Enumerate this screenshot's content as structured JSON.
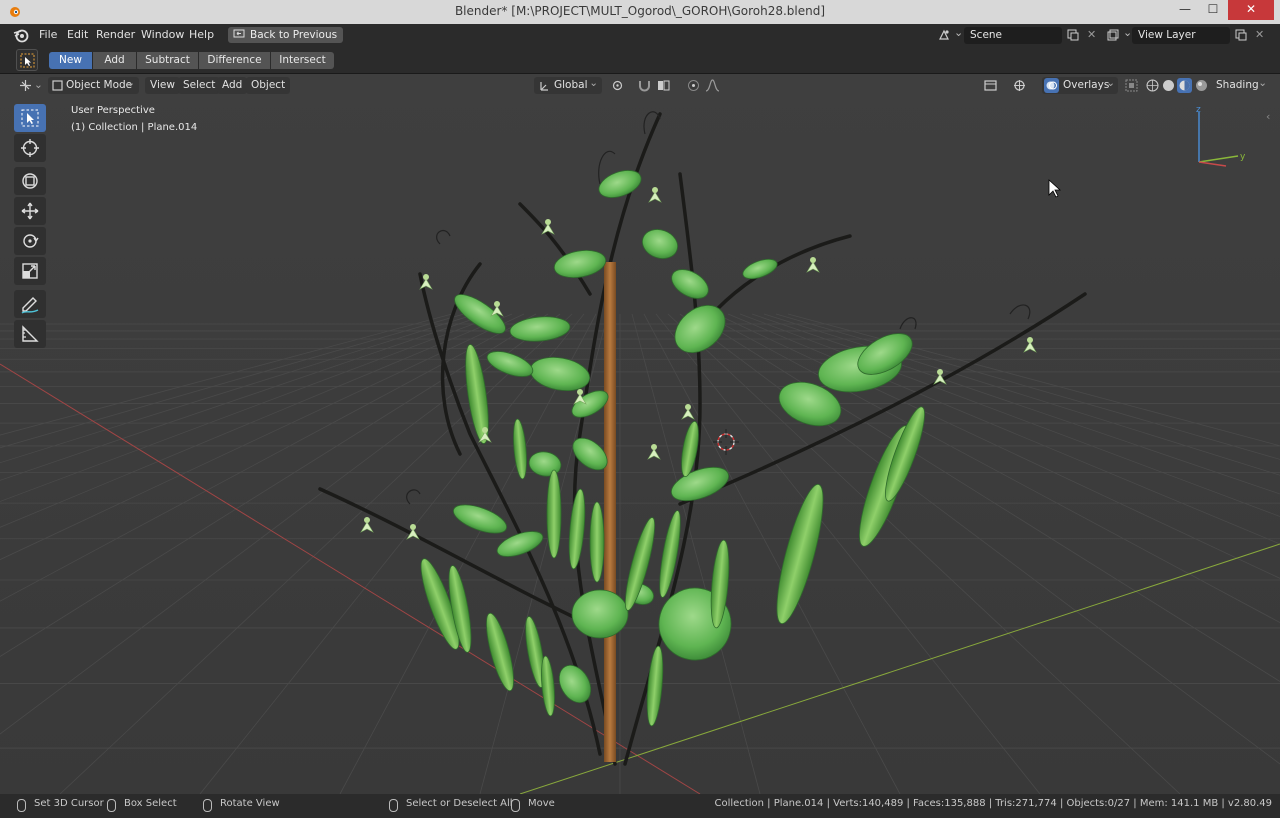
{
  "window": {
    "title": "Blender* [M:\\PROJECT\\MULT_Ogorod\\_GOROH\\Goroh28.blend]",
    "min_glyph": "—",
    "max_glyph": "☐",
    "close_glyph": "✕"
  },
  "topbar": {
    "menus": [
      "File",
      "Edit",
      "Render",
      "Window",
      "Help"
    ],
    "back_button": "Back to Previous",
    "scene": "Scene",
    "view_layer": "View Layer"
  },
  "toolheader": {
    "modes": [
      "New",
      "Add",
      "Subtract",
      "Difference",
      "Intersect"
    ],
    "active_mode": "New"
  },
  "viewport": {
    "header": {
      "mode": "Object Mode",
      "menus": [
        "View",
        "Select",
        "Add",
        "Object"
      ],
      "transform_orientation": "Global",
      "overlays": "Overlays",
      "shading": "Shading"
    },
    "info": {
      "perspective": "User Perspective",
      "collection": "(1) Collection | Plane.014"
    },
    "gizmo": {
      "z": "z",
      "y": "y"
    }
  },
  "statusbar": {
    "set_cursor": "Set 3D Cursor",
    "box_select": "Box Select",
    "rotate_view": "Rotate View",
    "select_deselect": "Select or Deselect All",
    "move": "Move",
    "stats": "Collection | Plane.014 | Verts:140,489 | Faces:135,888 | Tris:271,774 | Objects:0/27 | Mem: 141.1 MB | v2.80.49"
  },
  "colors": {
    "accent": "#4772b3",
    "x_axis": "#b34a4a",
    "y_axis": "#8aab3a",
    "stem": "#1c1c1a",
    "leaf": "#4fa844",
    "pod": "#6ab84a",
    "stake": "#a66a35"
  }
}
